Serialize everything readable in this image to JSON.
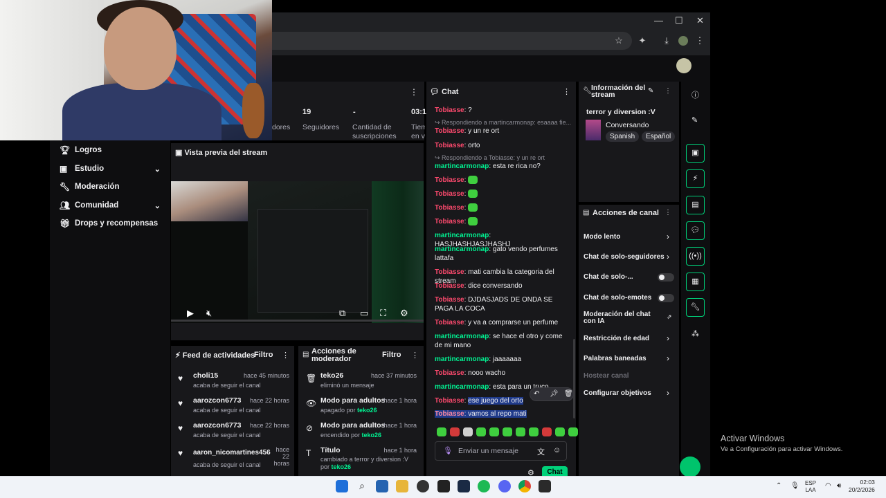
{
  "browser": {
    "minimize": "—",
    "maximize": "☐",
    "close": "✕"
  },
  "nav": {
    "items": [
      {
        "label": "Logros",
        "chev": ""
      },
      {
        "label": "Estudio",
        "chev": "⌄"
      },
      {
        "label": "Moderación",
        "chev": ""
      },
      {
        "label": "Comunidad",
        "chev": "⌄"
      },
      {
        "label": "Drops y recompensas",
        "chev": ""
      }
    ]
  },
  "stats": {
    "values": [
      "19",
      "-",
      "03:1"
    ],
    "labels": [
      "dores",
      "Seguidores",
      "Cantidad de suscripciones",
      "Tiem en v"
    ]
  },
  "preview": {
    "title": "Vista previa del stream"
  },
  "feed": {
    "title": "Feed de actividades",
    "filter": "Filtro",
    "items": [
      {
        "name": "choli15",
        "time": "hace 45 minutos",
        "sub": "acaba de seguir el canal"
      },
      {
        "name": "aarozcon6773",
        "time": "hace 22 horas",
        "sub": "acaba de seguir el canal"
      },
      {
        "name": "aarozcon6773",
        "time": "hace 22 horas",
        "sub": "acaba de seguir el canal"
      },
      {
        "name": "aaron_nicomartines456",
        "time": "hace 22 horas",
        "sub": "acaba de seguir el canal"
      }
    ]
  },
  "mod": {
    "title": "Acciones de moderador",
    "filter": "Filtro",
    "items": [
      {
        "name": "teko26",
        "time": "hace 37 minutos",
        "sub": "eliminó un mensaje",
        "by": ""
      },
      {
        "name": "Modo para adultos",
        "time": "hace 1 hora",
        "sub": "apagado por ",
        "by": "teko26"
      },
      {
        "name": "Modo para adultos",
        "time": "hace 1 hora",
        "sub": "encendido por ",
        "by": "teko26"
      },
      {
        "name": "Título",
        "time": "hace 1 hora",
        "sub": "cambiado a terror y diversion :V por ",
        "by": "teko26"
      }
    ]
  },
  "chat": {
    "title": "Chat",
    "placeholder": "Enviar un mensaje",
    "send": "Chat",
    "reply1": "Respondiendo a martincarmonap: esaaaa fie...",
    "reply2": "Respondiendo a Tobiasse: y un re ort",
    "m": [
      {
        "u": "Tobiasse",
        "t": "?"
      },
      {
        "u": "Tobiasse",
        "t": "y un re ort"
      },
      {
        "u": "Tobiasse",
        "t": "orto"
      },
      {
        "u": "martincarmonap",
        "t": "esta re rica no?"
      },
      {
        "u": "martincarmonap",
        "t": "HASJHASHJASJHASHJ"
      },
      {
        "u": "martincarmonap",
        "t": "gato vendo perfumes lattafa"
      },
      {
        "u": "Tobiasse",
        "t": "mati cambia la categoria del stream"
      },
      {
        "u": "Tobiasse",
        "t": "dice conversando"
      },
      {
        "u": "Tobiasse",
        "t": "DJDASJADS DE ONDA SE PAGA LA COCA"
      },
      {
        "u": "Tobiasse",
        "t": "y va a comprarse un perfume"
      },
      {
        "u": "martincarmonap",
        "t": "se hace el otro y come de mi mano"
      },
      {
        "u": "martincarmonap",
        "t": "jaaaaaaa"
      },
      {
        "u": "Tobiasse",
        "t": "nooo wacho"
      },
      {
        "u": "martincarmonap",
        "t": "esta para un truco"
      },
      {
        "u": "Tobiasse",
        "t": "ese juego del orto"
      },
      {
        "u": "Tobiasse",
        "t": "vamos al repo mati"
      }
    ],
    "emote_user": "Tobiasse"
  },
  "info": {
    "title": "Información del stream",
    "stream_title": "terror y diversion :V",
    "category": "Conversando",
    "tags": [
      "Spanish",
      "Español"
    ]
  },
  "actions": {
    "title": "Acciones de canal",
    "items": [
      "Modo lento",
      "Chat de solo-seguidores",
      "Chat de solo-...",
      "Chat de solo-emotes",
      "Moderación del chat con IA",
      "Restricción de edad",
      "Palabras baneadas",
      "Hostear canal",
      "Configurar objetivos"
    ]
  },
  "watermark": {
    "title": "Activar Windows",
    "sub": "Ve a Configuración para activar Windows."
  },
  "taskbar": {
    "lang1": "ESP",
    "lang2": "LAA",
    "time": "02:03",
    "date": "20/2/2026"
  },
  "colors": {
    "accent": "#00f593",
    "user_red": "#ff4a6e",
    "panel": "#18181b"
  }
}
